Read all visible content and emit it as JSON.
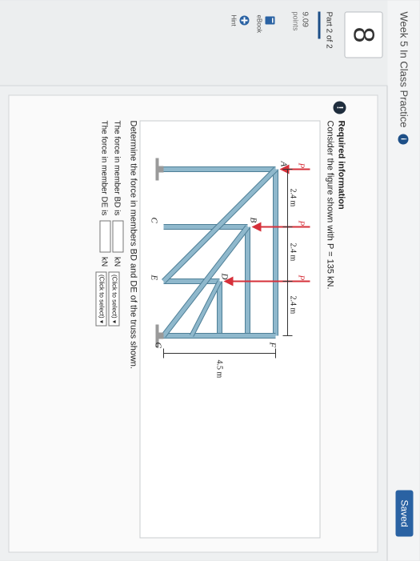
{
  "header": {
    "title": "Week 5 In Class Practice",
    "info_glyph": "i",
    "save_label": "Saved"
  },
  "sidebar": {
    "question_number": "8",
    "part_label": "Part 2 of 2",
    "points_value": "9.09",
    "points_label": "points",
    "tools": [
      {
        "label": "eBook",
        "icon": "book-icon"
      },
      {
        "label": "Hint",
        "icon": "hint-icon"
      }
    ]
  },
  "problem": {
    "alert_glyph": "!",
    "heading": "Required information",
    "statement": "Consider the figure shown with P = 135 kN.",
    "question": "Determine the force in members BD and DE of the truss shown.",
    "answers": [
      {
        "prefix": "The force in member BD is",
        "unit": "kN",
        "select_label": "(Click to select)"
      },
      {
        "prefix": "The force in member DE is",
        "unit": "kN",
        "select_label": "(Click to select)"
      }
    ]
  },
  "figure": {
    "node_labels": {
      "A": "A",
      "B": "B",
      "C": "C",
      "D": "D",
      "E": "E",
      "F": "F",
      "G": "G"
    },
    "load_label": "P",
    "dimensions": {
      "vertical": [
        "2.4 m",
        "2.4 m",
        "2.4 m"
      ],
      "horizontal": "4.5 m"
    },
    "colors": {
      "member": "#8fb8cc",
      "member_edge": "#4e7f97",
      "load": "#d6303a",
      "support": "#9a9a9a"
    }
  }
}
